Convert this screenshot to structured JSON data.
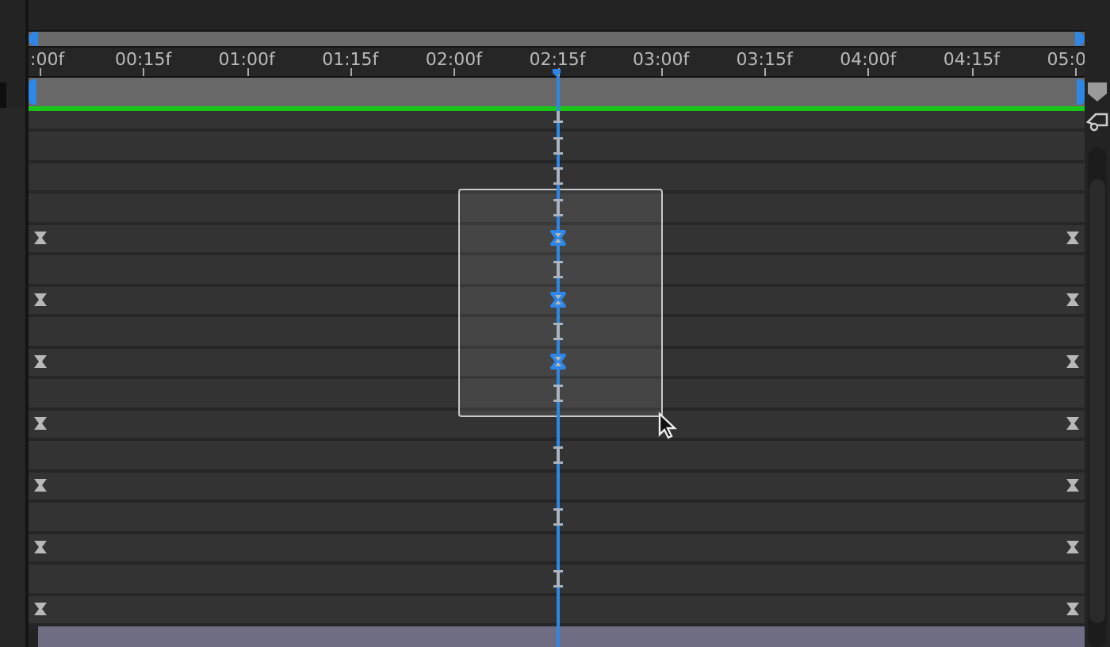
{
  "ruler": {
    "labels": [
      ":00f",
      "00:15f",
      "01:00f",
      "01:15f",
      "02:00f",
      "02:15f",
      "03:00f",
      "03:15f",
      "04:00f",
      "04:15f",
      "05:0"
    ]
  },
  "playhead": {
    "level": 0.5
  },
  "rows": [
    {
      "middle": {
        "kind": "i-beam",
        "selected": false
      }
    },
    {
      "middle": {
        "kind": "i-beam",
        "selected": false
      }
    },
    {
      "middle": {
        "kind": "i-beam",
        "selected": false
      }
    },
    {
      "middle": {
        "kind": "i-beam",
        "selected": false
      }
    },
    {
      "start": {
        "kind": "hourglass",
        "selected": false
      },
      "middle": {
        "kind": "hourglass",
        "selected": true
      },
      "end": {
        "kind": "hourglass",
        "selected": false
      }
    },
    {
      "middle": {
        "kind": "i-beam",
        "selected": false
      }
    },
    {
      "start": {
        "kind": "hourglass",
        "selected": false
      },
      "middle": {
        "kind": "hourglass",
        "selected": true
      },
      "end": {
        "kind": "hourglass",
        "selected": false
      }
    },
    {
      "middle": {
        "kind": "i-beam",
        "selected": false
      }
    },
    {
      "start": {
        "kind": "hourglass",
        "selected": false
      },
      "middle": {
        "kind": "hourglass",
        "selected": true
      },
      "end": {
        "kind": "hourglass",
        "selected": false
      }
    },
    {
      "middle": {
        "kind": "i-beam",
        "selected": false
      }
    },
    {
      "start": {
        "kind": "hourglass",
        "selected": false
      },
      "end": {
        "kind": "hourglass",
        "selected": false
      }
    },
    {
      "middle": {
        "kind": "i-beam",
        "selected": false
      }
    },
    {
      "start": {
        "kind": "hourglass",
        "selected": false
      },
      "end": {
        "kind": "hourglass",
        "selected": false
      }
    },
    {
      "middle": {
        "kind": "i-beam",
        "selected": false
      }
    },
    {
      "start": {
        "kind": "hourglass",
        "selected": false
      },
      "end": {
        "kind": "hourglass",
        "selected": false
      }
    },
    {
      "middle": {
        "kind": "i-beam",
        "selected": false
      }
    },
    {
      "start": {
        "kind": "hourglass",
        "selected": false
      },
      "end": {
        "kind": "hourglass",
        "selected": false
      }
    }
  ]
}
